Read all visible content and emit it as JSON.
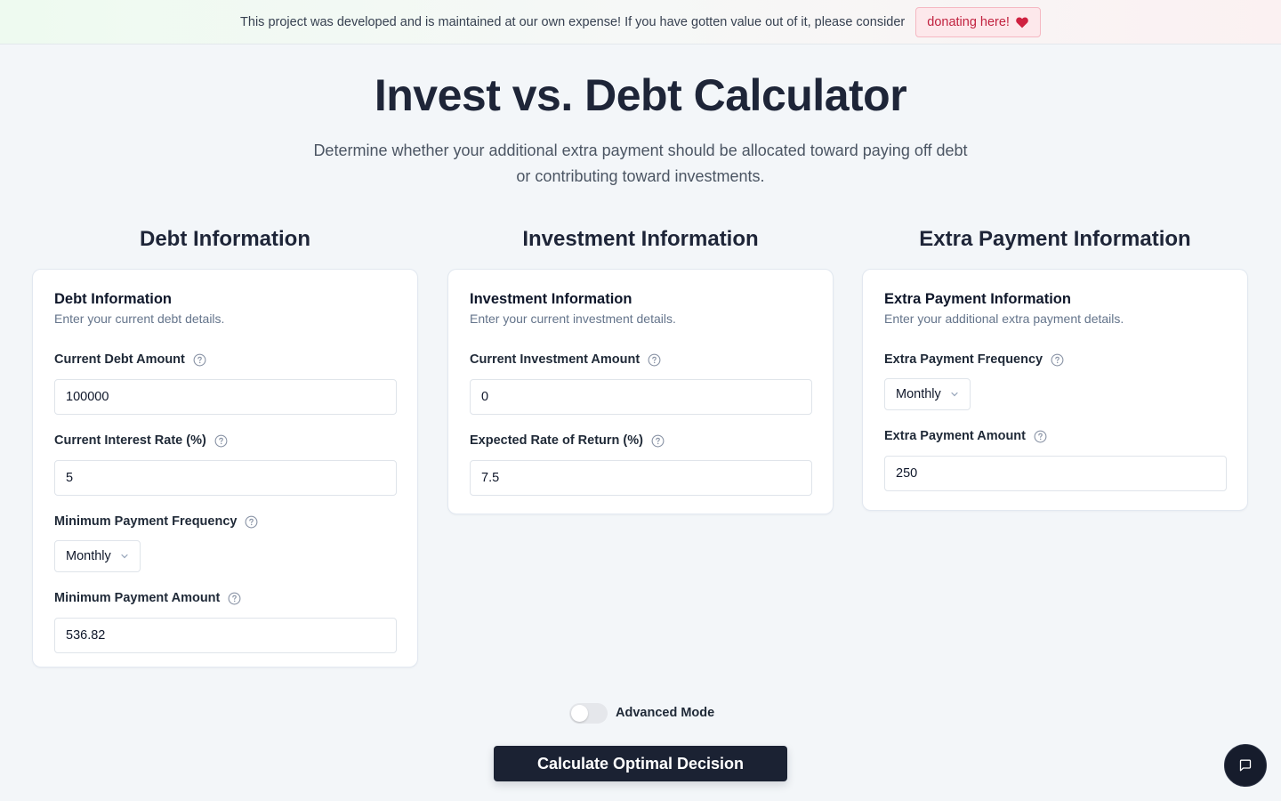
{
  "banner": {
    "text": "This project was developed and is maintained at our own expense! If you have gotten value out of it, please consider",
    "donate_label": "donating here!",
    "icon": "heart-icon"
  },
  "page": {
    "title": "Invest vs. Debt Calculator",
    "subtitle": "Determine whether your additional extra payment should be allocated toward paying off debt or contributing toward investments."
  },
  "debt": {
    "heading": "Debt Information",
    "card_title": "Debt Information",
    "card_desc": "Enter your current debt details.",
    "amount_label": "Current Debt Amount",
    "amount_value": "100000",
    "rate_label": "Current Interest Rate (%)",
    "rate_value": "5",
    "frequency_label": "Minimum Payment Frequency",
    "frequency_value": "Monthly",
    "min_payment_label": "Minimum Payment Amount",
    "min_payment_value": "536.82"
  },
  "investment": {
    "heading": "Investment Information",
    "card_title": "Investment Information",
    "card_desc": "Enter your current investment details.",
    "amount_label": "Current Investment Amount",
    "amount_value": "0",
    "return_label": "Expected Rate of Return (%)",
    "return_value": "7.5"
  },
  "extra": {
    "heading": "Extra Payment Information",
    "card_title": "Extra Payment Information",
    "card_desc": "Enter your additional extra payment details.",
    "frequency_label": "Extra Payment Frequency",
    "frequency_value": "Monthly",
    "amount_label": "Extra Payment Amount",
    "amount_value": "250"
  },
  "advanced_mode": {
    "label": "Advanced Mode",
    "enabled": false
  },
  "calculate_label": "Calculate Optimal Decision",
  "icons": {
    "help": "help-circle-icon",
    "chevron": "chevron-down-icon",
    "chat": "chat-bubble-icon"
  },
  "colors": {
    "primary": "#1b2233",
    "donate": "#c1223f",
    "background": "#f3f6f9"
  }
}
